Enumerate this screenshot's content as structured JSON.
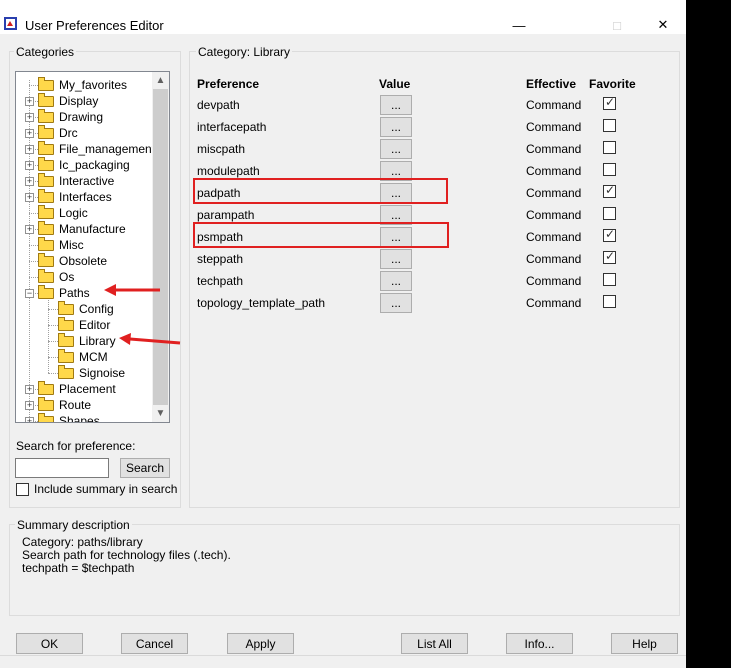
{
  "window": {
    "title": "User Preferences Editor",
    "controls": {
      "minimize": "—",
      "maximize": "□",
      "close": "✕"
    }
  },
  "categories": {
    "label": "Categories",
    "items": [
      {
        "label": "My_favorites",
        "expandable": false,
        "indent": 0
      },
      {
        "label": "Display",
        "expandable": true,
        "indent": 0
      },
      {
        "label": "Drawing",
        "expandable": true,
        "indent": 0
      },
      {
        "label": "Drc",
        "expandable": true,
        "indent": 0
      },
      {
        "label": "File_management",
        "expandable": true,
        "indent": 0
      },
      {
        "label": "Ic_packaging",
        "expandable": true,
        "indent": 0
      },
      {
        "label": "Interactive",
        "expandable": true,
        "indent": 0
      },
      {
        "label": "Interfaces",
        "expandable": true,
        "indent": 0
      },
      {
        "label": "Logic",
        "expandable": false,
        "indent": 0
      },
      {
        "label": "Manufacture",
        "expandable": true,
        "indent": 0
      },
      {
        "label": "Misc",
        "expandable": false,
        "indent": 0
      },
      {
        "label": "Obsolete",
        "expandable": false,
        "indent": 0
      },
      {
        "label": "Os",
        "expandable": false,
        "indent": 0
      },
      {
        "label": "Paths",
        "expandable": true,
        "expanded": true,
        "indent": 0
      },
      {
        "label": "Config",
        "expandable": false,
        "indent": 1
      },
      {
        "label": "Editor",
        "expandable": false,
        "indent": 1
      },
      {
        "label": "Library",
        "expandable": false,
        "indent": 1,
        "selected": true
      },
      {
        "label": "MCM",
        "expandable": false,
        "indent": 1
      },
      {
        "label": "Signoise",
        "expandable": false,
        "indent": 1
      },
      {
        "label": "Placement",
        "expandable": true,
        "indent": 0
      },
      {
        "label": "Route",
        "expandable": true,
        "indent": 0
      },
      {
        "label": "Shapes",
        "expandable": true,
        "indent": 0
      }
    ]
  },
  "search": {
    "label": "Search for preference:",
    "value": "",
    "button": "Search",
    "include_summary_label": "Include summary in search",
    "include_summary_checked": false
  },
  "category_panel": {
    "label": "Category:  Library",
    "headers": {
      "preference": "Preference",
      "value": "Value",
      "effective": "Effective",
      "favorite": "Favorite"
    },
    "value_button": "...",
    "rows": [
      {
        "name": "devpath",
        "effective": "Command",
        "favorite": true
      },
      {
        "name": "interfacepath",
        "effective": "Command",
        "favorite": false
      },
      {
        "name": "miscpath",
        "effective": "Command",
        "favorite": false
      },
      {
        "name": "modulepath",
        "effective": "Command",
        "favorite": false
      },
      {
        "name": "padpath",
        "effective": "Command",
        "favorite": true,
        "highlighted": true
      },
      {
        "name": "parampath",
        "effective": "Command",
        "favorite": false
      },
      {
        "name": "psmpath",
        "effective": "Command",
        "favorite": true,
        "highlighted": true
      },
      {
        "name": "steppath",
        "effective": "Command",
        "favorite": true
      },
      {
        "name": "techpath",
        "effective": "Command",
        "favorite": false
      },
      {
        "name": "topology_template_path",
        "effective": "Command",
        "favorite": false
      }
    ]
  },
  "summary": {
    "label": "Summary description",
    "lines": [
      "Category: paths/library",
      "Search path for technology files (.tech).",
      "techpath = $techpath"
    ]
  },
  "buttons": {
    "ok": "OK",
    "cancel": "Cancel",
    "apply": "Apply",
    "list_all": "List All",
    "info": "Info...",
    "help": "Help"
  },
  "colors": {
    "annotation": "#e02020",
    "folder": "#ffd84a",
    "window_bg": "#f0f0f0"
  }
}
